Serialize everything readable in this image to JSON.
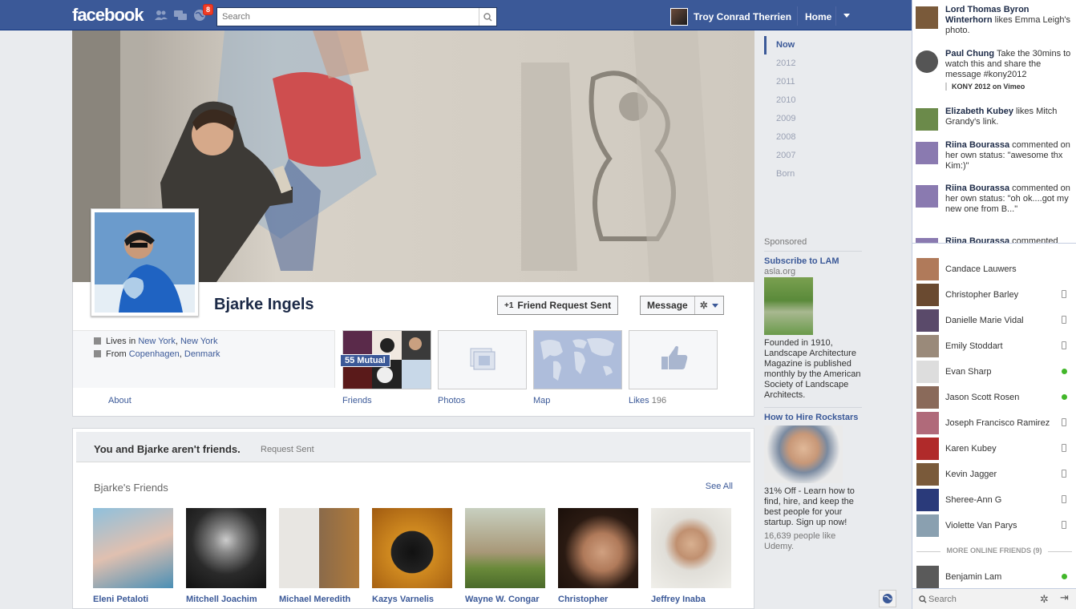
{
  "topbar": {
    "logo": "facebook",
    "notification_count": "8",
    "search_placeholder": "Search",
    "user_name": "Troy Conrad Therrien",
    "home_label": "Home"
  },
  "profile": {
    "name": "Bjarke Ingels",
    "friend_request_label": "Friend Request Sent",
    "message_label": "Message",
    "lives_prefix": "Lives in",
    "lives_city": "New York",
    "lives_sep": ", ",
    "lives_state": "New York",
    "from_prefix": "From",
    "from_city": "Copenhagen",
    "from_sep": ", ",
    "from_country": "Denmark",
    "about_label": "About",
    "mutual_label": "55 Mutual",
    "tiles": {
      "friends": "Friends",
      "photos": "Photos",
      "map": "Map",
      "likes": "Likes",
      "likes_count": "196"
    }
  },
  "relationship": {
    "status": "You and Bjarke aren't friends.",
    "request": "Request Sent"
  },
  "friends_section": {
    "title": "Bjarke's Friends",
    "see_all": "See All",
    "friends": [
      {
        "name": "Eleni Petaloti",
        "color": "#4a8fb5"
      },
      {
        "name": "Mitchell Joachim",
        "color": "#3a3a3a"
      },
      {
        "name": "Michael Meredith",
        "color": "#8a7d6a"
      },
      {
        "name": "Kazys Varnelis",
        "color": "#6b4a20"
      },
      {
        "name": "Wayne W. Congar",
        "color": "#8f7f5f"
      },
      {
        "name": "Christopher",
        "color": "#5a3a2a"
      },
      {
        "name": "Jeffrey Inaba",
        "color": "#b0a090"
      }
    ]
  },
  "timeline_nav": [
    "Now",
    "2012",
    "2011",
    "2010",
    "2009",
    "2008",
    "2007",
    "Born"
  ],
  "sponsored": {
    "label": "Sponsored",
    "ads": [
      {
        "title": "Subscribe to LAM",
        "url": "asla.org",
        "body": "Founded in 1910, Landscape Architecture Magazine is published monthly by the American Society of Landscape Architects."
      },
      {
        "title": "How to Hire Rockstars",
        "body": "31% Off - Learn how to find, hire, and keep the best people for your startup. Sign up now!",
        "meta": "16,639 people like Udemy."
      }
    ]
  },
  "ticker": [
    {
      "actor": "Lord Thomas Byron Winterhorn",
      "text": " likes Emma Leigh's photo.",
      "color": "#7a5a3a"
    },
    {
      "actor": "Paul Chung",
      "text": " Take the 30mins to watch this and share the message #kony2012",
      "attachment": "KONY 2012 on Vimeo",
      "color": "#555"
    },
    {
      "actor": "Elizabeth Kubey",
      "text": " likes Mitch Grandy's link.",
      "color": "#6b8a4a"
    },
    {
      "actor": "Riina Bourassa",
      "text": " commented on her own status: \"awesome thx Kim:)\"",
      "color": "#8a7ab0"
    },
    {
      "actor": "Riina Bourassa",
      "text": " commented on her own status: \"oh ok....got my new one from B...\"",
      "color": "#8a7ab0"
    },
    {
      "actor": "Riina Bourassa",
      "text": " commented",
      "color": "#8a7ab0"
    }
  ],
  "chat": {
    "contacts": [
      {
        "name": "Candace Lauwers",
        "status": "none",
        "color": "#b07a5a"
      },
      {
        "name": "Christopher Barley",
        "status": "mobile",
        "color": "#6a4a30"
      },
      {
        "name": "Danielle Marie Vidal",
        "status": "mobile",
        "color": "#5a4a6a"
      },
      {
        "name": "Emily Stoddart",
        "status": "mobile",
        "color": "#9a8a7a"
      },
      {
        "name": "Evan Sharp",
        "status": "online",
        "color": "#ddd"
      },
      {
        "name": "Jason Scott Rosen",
        "status": "online",
        "color": "#8a6a5a"
      },
      {
        "name": "Joseph Francisco Ramirez",
        "status": "mobile",
        "color": "#b06a7a"
      },
      {
        "name": "Karen Kubey",
        "status": "mobile",
        "color": "#b02a2a"
      },
      {
        "name": "Kevin Jagger",
        "status": "mobile",
        "color": "#7a5a3a"
      },
      {
        "name": "Sheree-Ann G",
        "status": "mobile",
        "color": "#2a3a7a"
      },
      {
        "name": "Violette Van Parys",
        "status": "mobile",
        "color": "#8aa0b0"
      }
    ],
    "more_online": "MORE ONLINE FRIENDS (9)",
    "more_contacts": [
      {
        "name": "Benjamin Lam",
        "status": "online",
        "color": "#5a5a5a"
      }
    ],
    "search_placeholder": "Search"
  }
}
